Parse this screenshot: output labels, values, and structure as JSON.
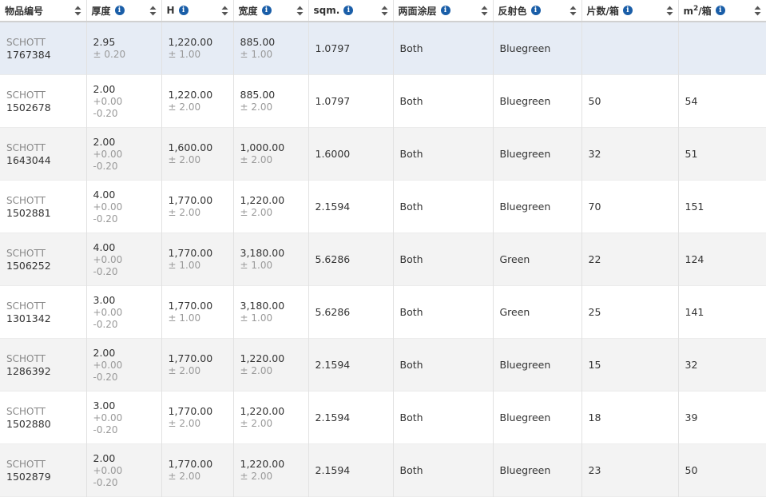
{
  "headers": [
    {
      "label": "物品编号",
      "info": false
    },
    {
      "label": "厚度",
      "info": true
    },
    {
      "label": "H",
      "info": true
    },
    {
      "label": "宽度",
      "info": true
    },
    {
      "label": "sqm.",
      "info": true
    },
    {
      "label": "两面涂层",
      "info": true
    },
    {
      "label": "反射色",
      "info": true
    },
    {
      "label": "片数/箱",
      "info": true
    },
    {
      "label": "m",
      "sup": "2",
      "suffix": "/箱",
      "info": true
    }
  ],
  "rows": [
    {
      "brand": "SCHOTT",
      "item": "1767384",
      "thick": "2.95",
      "thick_tol": [
        "± 0.20"
      ],
      "h": "1,220.00",
      "h_tol": "± 1.00",
      "w": "885.00",
      "w_tol": "± 1.00",
      "sqm": "1.0797",
      "coat": "Both",
      "color": "Bluegreen",
      "pcs": "",
      "m2": "",
      "state": "selected"
    },
    {
      "brand": "SCHOTT",
      "item": "1502678",
      "thick": "2.00",
      "thick_tol": [
        "+0.00",
        "-0.20"
      ],
      "h": "1,220.00",
      "h_tol": "± 2.00",
      "w": "885.00",
      "w_tol": "± 2.00",
      "sqm": "1.0797",
      "coat": "Both",
      "color": "Bluegreen",
      "pcs": "50",
      "m2": "54",
      "state": "odd"
    },
    {
      "brand": "SCHOTT",
      "item": "1643044",
      "thick": "2.00",
      "thick_tol": [
        "+0.00",
        "-0.20"
      ],
      "h": "1,600.00",
      "h_tol": "± 2.00",
      "w": "1,000.00",
      "w_tol": "± 2.00",
      "sqm": "1.6000",
      "coat": "Both",
      "color": "Bluegreen",
      "pcs": "32",
      "m2": "51",
      "state": "even"
    },
    {
      "brand": "SCHOTT",
      "item": "1502881",
      "thick": "4.00",
      "thick_tol": [
        "+0.00",
        "-0.20"
      ],
      "h": "1,770.00",
      "h_tol": "± 2.00",
      "w": "1,220.00",
      "w_tol": "± 2.00",
      "sqm": "2.1594",
      "coat": "Both",
      "color": "Bluegreen",
      "pcs": "70",
      "m2": "151",
      "state": "odd"
    },
    {
      "brand": "SCHOTT",
      "item": "1506252",
      "thick": "4.00",
      "thick_tol": [
        "+0.00",
        "-0.20"
      ],
      "h": "1,770.00",
      "h_tol": "± 1.00",
      "w": "3,180.00",
      "w_tol": "± 1.00",
      "sqm": "5.6286",
      "coat": "Both",
      "color": "Green",
      "pcs": "22",
      "m2": "124",
      "state": "even"
    },
    {
      "brand": "SCHOTT",
      "item": "1301342",
      "thick": "3.00",
      "thick_tol": [
        "+0.00",
        "-0.20"
      ],
      "h": "1,770.00",
      "h_tol": "± 1.00",
      "w": "3,180.00",
      "w_tol": "± 1.00",
      "sqm": "5.6286",
      "coat": "Both",
      "color": "Green",
      "pcs": "25",
      "m2": "141",
      "state": "odd"
    },
    {
      "brand": "SCHOTT",
      "item": "1286392",
      "thick": "2.00",
      "thick_tol": [
        "+0.00",
        "-0.20"
      ],
      "h": "1,770.00",
      "h_tol": "± 2.00",
      "w": "1,220.00",
      "w_tol": "± 2.00",
      "sqm": "2.1594",
      "coat": "Both",
      "color": "Bluegreen",
      "pcs": "15",
      "m2": "32",
      "state": "even"
    },
    {
      "brand": "SCHOTT",
      "item": "1502880",
      "thick": "3.00",
      "thick_tol": [
        "+0.00",
        "-0.20"
      ],
      "h": "1,770.00",
      "h_tol": "± 2.00",
      "w": "1,220.00",
      "w_tol": "± 2.00",
      "sqm": "2.1594",
      "coat": "Both",
      "color": "Bluegreen",
      "pcs": "18",
      "m2": "39",
      "state": "odd"
    },
    {
      "brand": "SCHOTT",
      "item": "1502879",
      "thick": "2.00",
      "thick_tol": [
        "+0.00",
        "-0.20"
      ],
      "h": "1,770.00",
      "h_tol": "± 2.00",
      "w": "1,220.00",
      "w_tol": "± 2.00",
      "sqm": "2.1594",
      "coat": "Both",
      "color": "Bluegreen",
      "pcs": "23",
      "m2": "50",
      "state": "even"
    }
  ],
  "icons": {
    "info": "info-icon",
    "sort": "sort-icon"
  },
  "colors": {
    "info_icon": "#1a5ea8",
    "selected_row": "#e6ecf5",
    "alt_row": "#f3f3f3"
  }
}
